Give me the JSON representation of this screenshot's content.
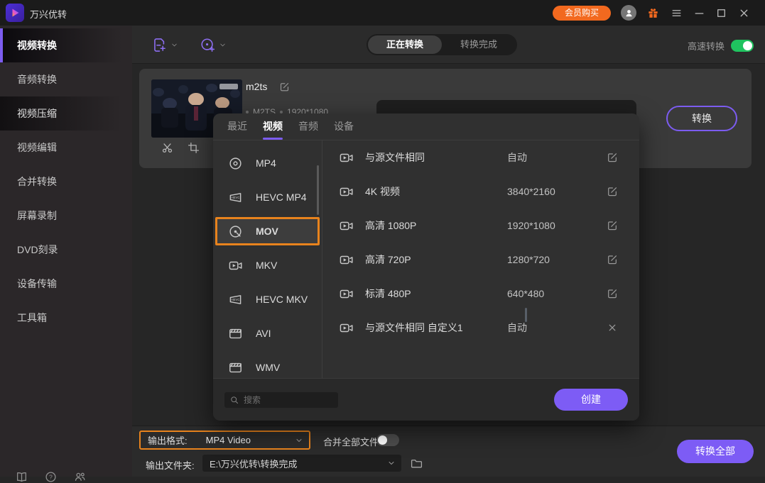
{
  "titlebar": {
    "app_name": "万兴优转",
    "member_button": "会员购买"
  },
  "sidebar": {
    "items": [
      "视频转换",
      "音频转换",
      "视频压缩",
      "视频编辑",
      "合并转换",
      "屏幕录制",
      "DVD刻录",
      "设备传输",
      "工具箱"
    ],
    "active_item": "视频转换"
  },
  "toolbar": {
    "tab_converting": "正在转换",
    "tab_finished": "转换完成",
    "speed_label": "高速转换",
    "speed_on": true
  },
  "file_card": {
    "name": "m2ts",
    "format": "M2TS",
    "resolution": "1920*1080",
    "convert_button": "转换"
  },
  "format_picker": {
    "tabs": {
      "recent": "最近",
      "video": "视频",
      "audio": "音频",
      "device": "设备"
    },
    "active_tab": "视频",
    "formats": [
      {
        "label": "MP4",
        "icon": "disc-icon"
      },
      {
        "label": "HEVC MP4",
        "icon": "hevc-icon"
      },
      {
        "label": "MOV",
        "icon": "quicktime-icon",
        "selected": true
      },
      {
        "label": "MKV",
        "icon": "camcorder-icon"
      },
      {
        "label": "HEVC MKV",
        "icon": "hevc-icon"
      },
      {
        "label": "AVI",
        "icon": "clapperboard-icon"
      },
      {
        "label": "WMV",
        "icon": "clapperboard-icon"
      }
    ],
    "presets": [
      {
        "name": "与源文件相同",
        "value": "自动",
        "action": "edit"
      },
      {
        "name": "4K 视频",
        "value": "3840*2160",
        "action": "edit"
      },
      {
        "name": "高清 1080P",
        "value": "1920*1080",
        "action": "edit"
      },
      {
        "name": "高清 720P",
        "value": "1280*720",
        "action": "edit"
      },
      {
        "name": "标清 480P",
        "value": "640*480",
        "action": "edit"
      },
      {
        "name": "与源文件相同 自定义1",
        "value": "自动",
        "action": "remove"
      }
    ],
    "search_placeholder": "搜索",
    "create_button": "创建"
  },
  "output_bar": {
    "format_label": "输出格式:",
    "format_value": "MP4 Video",
    "merge_label": "合并全部文件",
    "merge_on": false,
    "folder_label": "输出文件夹:",
    "folder_path": "E:\\万兴优转\\转换完成",
    "convert_all_button": "转换全部"
  },
  "colors": {
    "accent_purple": "#7c5cf0",
    "highlight_orange": "#e8831d",
    "brand_orange": "#f2691f",
    "toggle_green": "#1fc35f"
  }
}
